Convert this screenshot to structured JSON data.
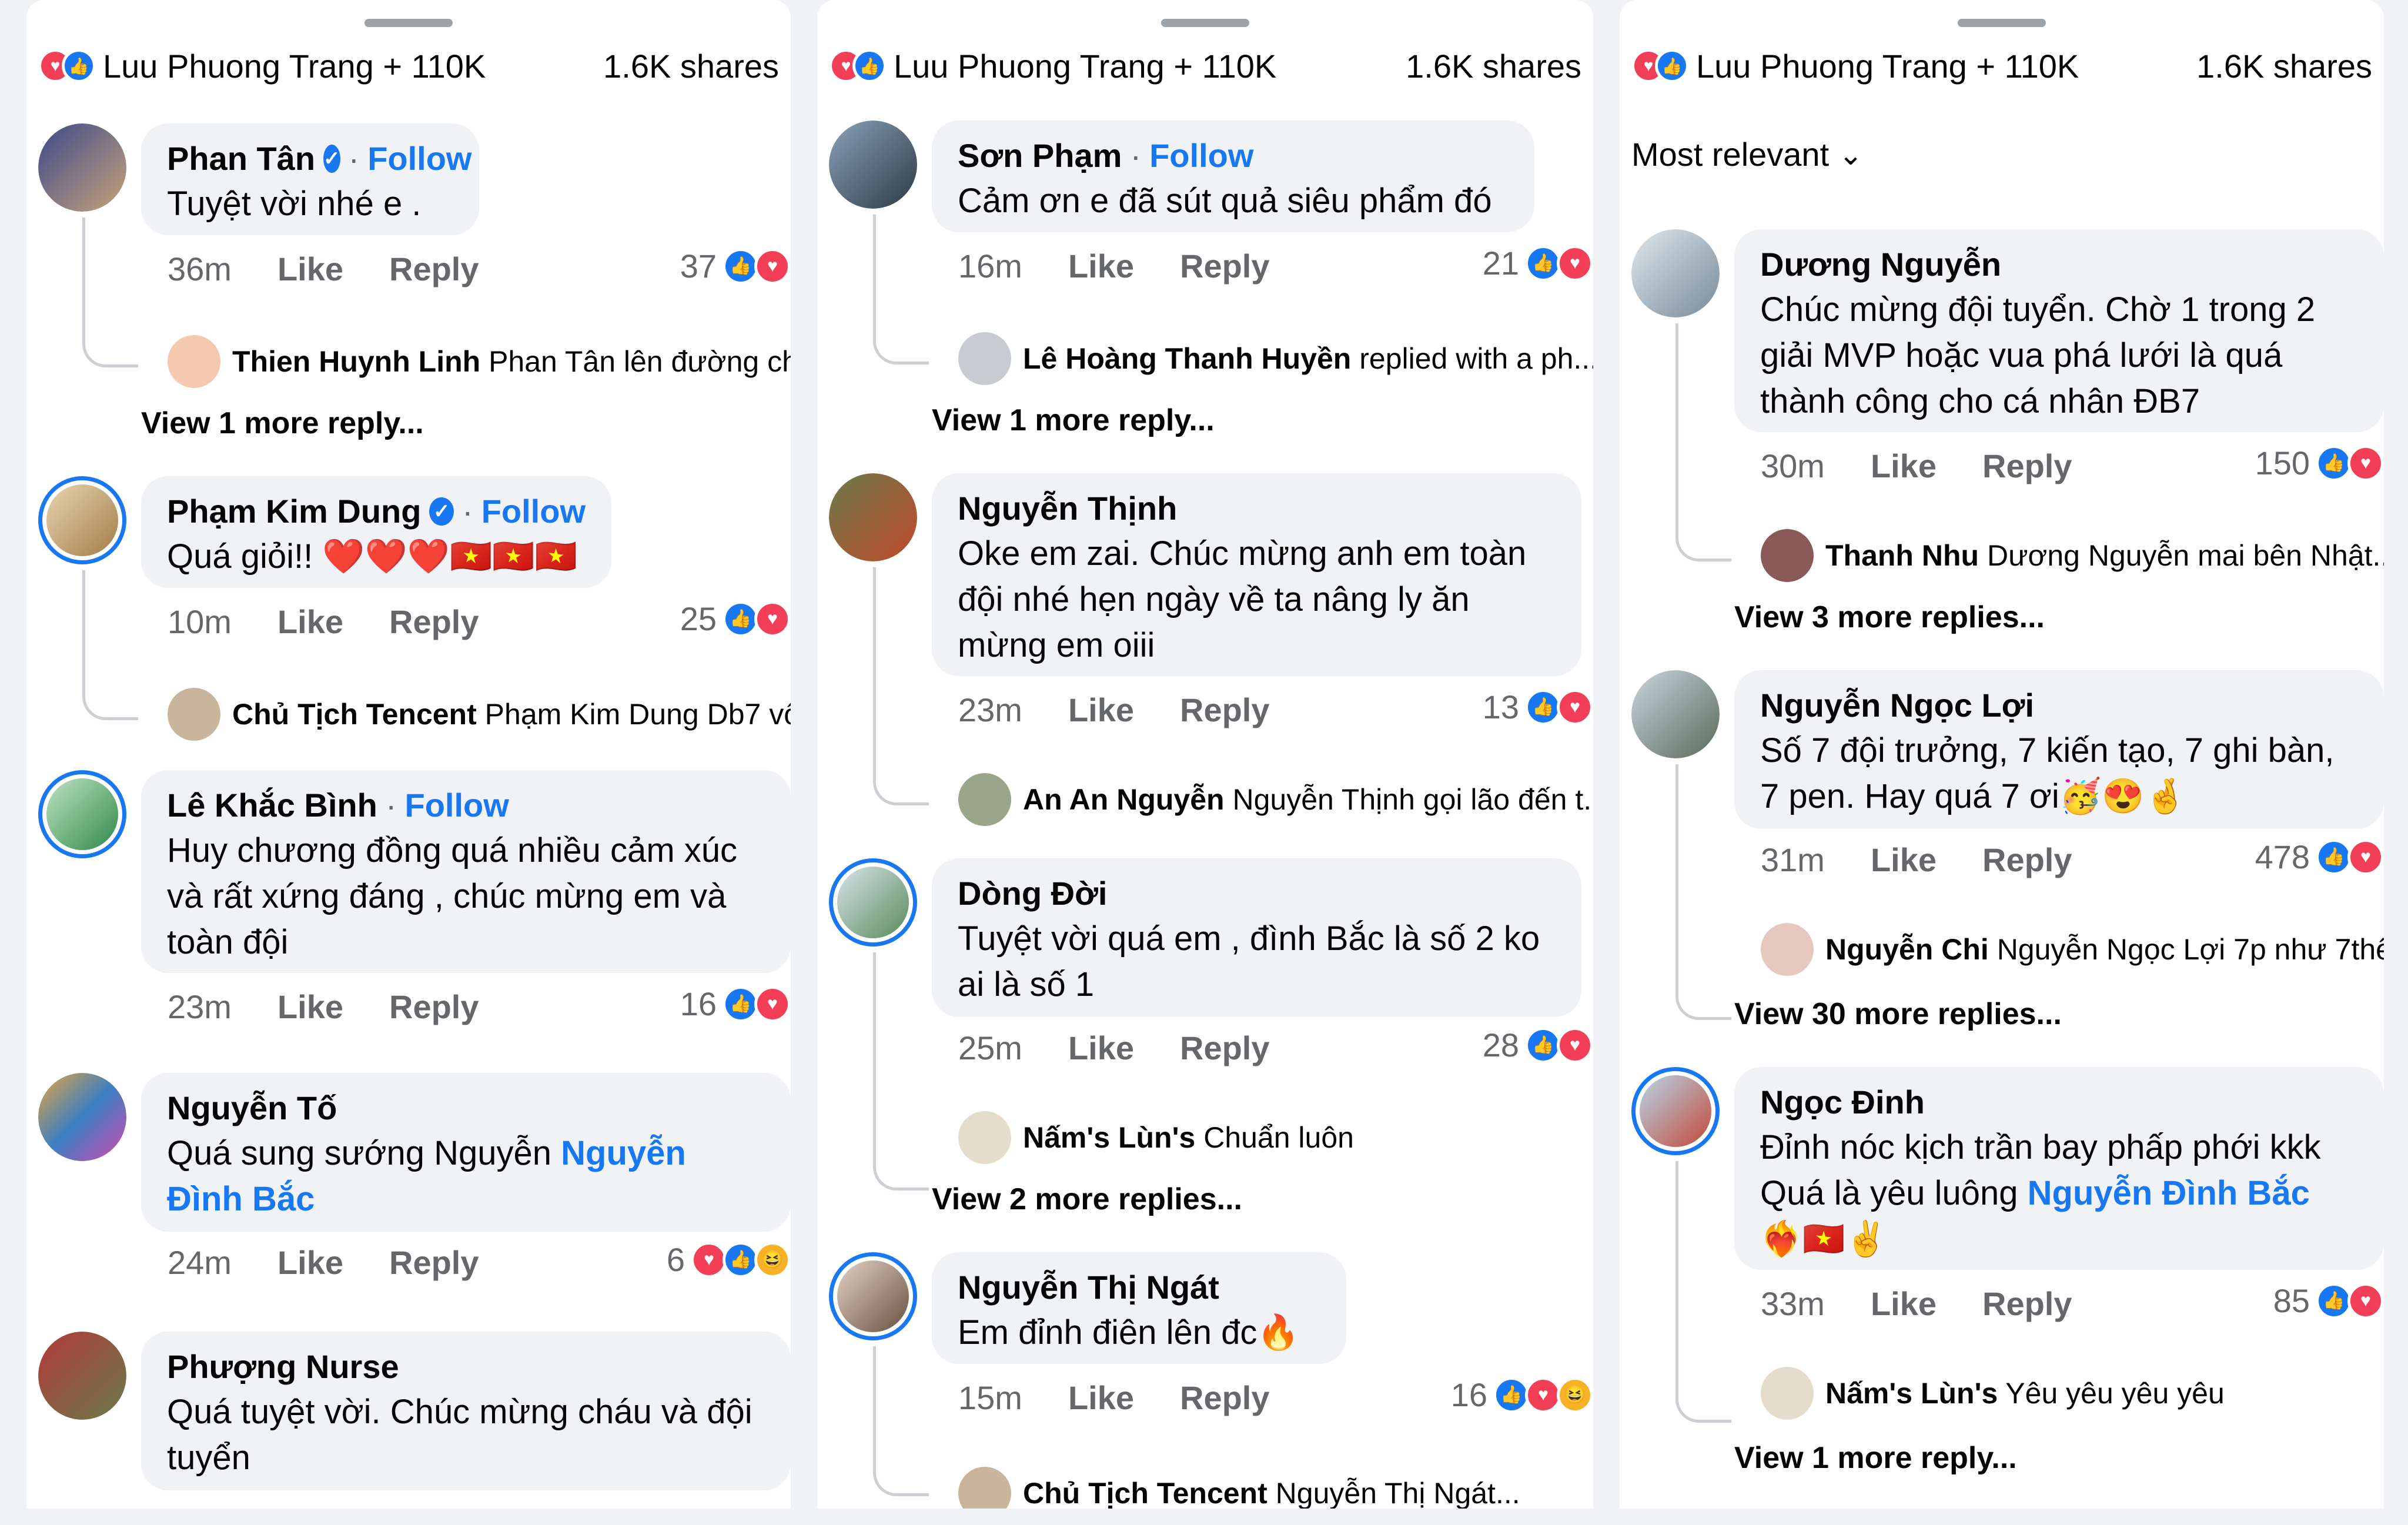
{
  "panels": [
    {
      "header": {
        "names": "Luu Phuong Trang + 110K",
        "shares": "1.6K shares"
      },
      "comments": [
        {
          "name": "Phan Tân",
          "verified": true,
          "follow": "Follow",
          "text": "Tuyệt vời nhé e .",
          "time": "36m",
          "like": "Like",
          "reply": "Reply",
          "count": "37",
          "reply_preview": {
            "name": "Thien Huynh Linh",
            "text": "Phan Tân lên đường ch..."
          },
          "more": "View 1 more reply..."
        },
        {
          "name": "Phạm Kim Dung",
          "verified": true,
          "follow": "Follow",
          "text": "Quá giỏi!! ❤️❤️❤️🇻🇳🇻🇳🇻🇳",
          "time": "10m",
          "like": "Like",
          "reply": "Reply",
          "count": "25",
          "reply_preview": {
            "name": "Chủ Tịch Tencent",
            "text": "Phạm Kim Dung Db7 vô..."
          }
        },
        {
          "name": "Lê Khắc Bình",
          "follow": "Follow",
          "text": "Huy chương đồng quá nhiều cảm xúc và rất xứng đáng , chúc mừng em và toàn đội",
          "time": "23m",
          "like": "Like",
          "reply": "Reply",
          "count": "16"
        },
        {
          "name": "Nguyễn Tố",
          "text_prefix": "Quá sung sướng Nguyễn ",
          "mention": "Nguyễn Đình Bắc",
          "time": "24m",
          "like": "Like",
          "reply": "Reply",
          "count": "6"
        },
        {
          "name": "Phượng Nurse",
          "text": "Quá tuyệt vời. Chúc mừng cháu và đội tuyển"
        }
      ]
    },
    {
      "header": {
        "names": "Luu Phuong Trang + 110K",
        "shares": "1.6K shares"
      },
      "comments": [
        {
          "name": "Sơn Phạm",
          "follow": "Follow",
          "text": "Cảm ơn e đã sút quả siêu phẩm đó",
          "time": "16m",
          "like": "Like",
          "reply": "Reply",
          "count": "21",
          "reply_preview": {
            "name": "Lê Hoàng Thanh Huyền",
            "text": "replied with a ph..."
          },
          "more": "View 1 more reply..."
        },
        {
          "name": "Nguyễn Thịnh",
          "text": "Oke em zai. Chúc mừng anh em toàn đội nhé hẹn ngày về ta nâng ly ăn mừng em oiii",
          "time": "23m",
          "like": "Like",
          "reply": "Reply",
          "count": "13",
          "reply_preview": {
            "name": "An An Nguyễn",
            "text": "Nguyễn Thịnh gọi lão đến t..."
          }
        },
        {
          "name": "Dòng Đời",
          "text": "Tuyệt vời quá em , đình Bắc là số 2 ko ai là số 1",
          "time": "25m",
          "like": "Like",
          "reply": "Reply",
          "count": "28",
          "reply_preview": {
            "name": "Nấm's Lùn's",
            "text": "Chuẩn luôn"
          },
          "more": "View 2 more replies..."
        },
        {
          "name": "Nguyễn Thị Ngát",
          "text": "Em đỉnh điên lên đc🔥",
          "time": "15m",
          "like": "Like",
          "reply": "Reply",
          "count": "16",
          "reply_preview": {
            "name": "Chủ Tịch Tencent",
            "text": "Nguyễn Thị Ngát..."
          }
        }
      ]
    },
    {
      "header": {
        "names": "Luu Phuong Trang + 110K",
        "shares": "1.6K shares"
      },
      "sort": "Most relevant",
      "comments": [
        {
          "name": "Dương Nguyễn",
          "text": "Chúc mừng đội tuyển. Chờ 1 trong 2 giải MVP hoặc vua phá lưới là quá thành công cho cá nhân ĐB7",
          "time": "30m",
          "like": "Like",
          "reply": "Reply",
          "count": "150",
          "reply_preview": {
            "name": "Thanh Nhu",
            "text": "Dương Nguyễn mai  bên Nhật..."
          },
          "more": "View 3 more replies..."
        },
        {
          "name": "Nguyễn Ngọc Lợi",
          "text": "Số 7 đội trưởng, 7 kiến tạo, 7 ghi bàn, 7 pen. Hay quá 7 ơi🥳😍🤞",
          "time": "31m",
          "like": "Like",
          "reply": "Reply",
          "count": "478",
          "reply_preview": {
            "name": "Nguyễn Chi",
            "text": "Nguyễn Ngọc Lợi 7p như 7thế..."
          },
          "more": "View 30 more replies..."
        },
        {
          "name": "Ngọc Đinh",
          "text_prefix": "Đỉnh nóc kịch trần bay phấp phới kkk Quá là yêu luông ",
          "mention": "Nguyễn Đình Bắc",
          "text_suffix": " ❤️‍🔥🇻🇳✌️",
          "time": "33m",
          "like": "Like",
          "reply": "Reply",
          "count": "85",
          "reply_preview": {
            "name": "Nấm's Lùn's",
            "text": "Yêu yêu yêu yêu"
          },
          "more": "View 1 more reply..."
        }
      ]
    }
  ],
  "icons": {
    "love": "heart-icon",
    "like": "thumbs-up-icon",
    "haha": "haha-icon"
  },
  "colors": {
    "accent": "#1877f2",
    "love": "#f33e58",
    "bubble": "#f0f2f5",
    "muted": "#65676b"
  }
}
